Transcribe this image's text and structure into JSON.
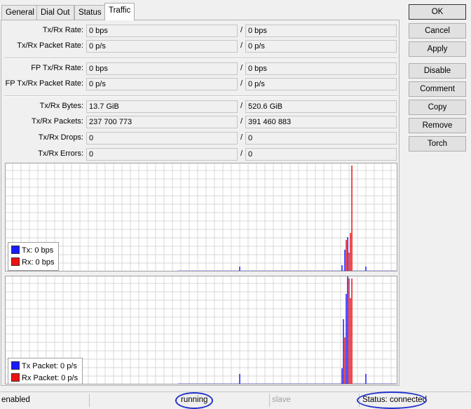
{
  "tabs": [
    "General",
    "Dial Out",
    "Status",
    "Traffic"
  ],
  "rows": [
    {
      "label": "Tx/Rx Rate:",
      "tx": "0 bps",
      "rx": "0 bps"
    },
    {
      "label": "Tx/Rx Packet Rate:",
      "tx": "0 p/s",
      "rx": "0 p/s"
    },
    {
      "label": "FP Tx/Rx Rate:",
      "tx": "0 bps",
      "rx": "0 bps"
    },
    {
      "label": "FP Tx/Rx Packet Rate:",
      "tx": "0 p/s",
      "rx": "0 p/s"
    },
    {
      "label": "Tx/Rx Bytes:",
      "tx": "13.7 GiB",
      "rx": "520.6 GiB"
    },
    {
      "label": "Tx/Rx Packets:",
      "tx": "237 700 773",
      "rx": "391 460 883"
    },
    {
      "label": "Tx/Rx Drops:",
      "tx": "0",
      "rx": "0"
    },
    {
      "label": "Tx/Rx Errors:",
      "tx": "0",
      "rx": "0"
    }
  ],
  "slash": "/",
  "legend_rate": {
    "tx": "Tx:  0 bps",
    "rx": "Rx:  0 bps"
  },
  "legend_packet": {
    "tx": "Tx Packet:  0 p/s",
    "rx": "Rx Packet:  0 p/s"
  },
  "buttons": [
    "OK",
    "Cancel",
    "Apply",
    "Disable",
    "Comment",
    "Copy",
    "Remove",
    "Torch"
  ],
  "status": {
    "enabled": "enabled",
    "running": "running",
    "slave": "slave",
    "connection": "Status: connected"
  },
  "colors": {
    "tx": "#1a1aff",
    "rx": "#ee1111",
    "grid": "#d9d9d9",
    "annotation": "#2233cc"
  }
}
